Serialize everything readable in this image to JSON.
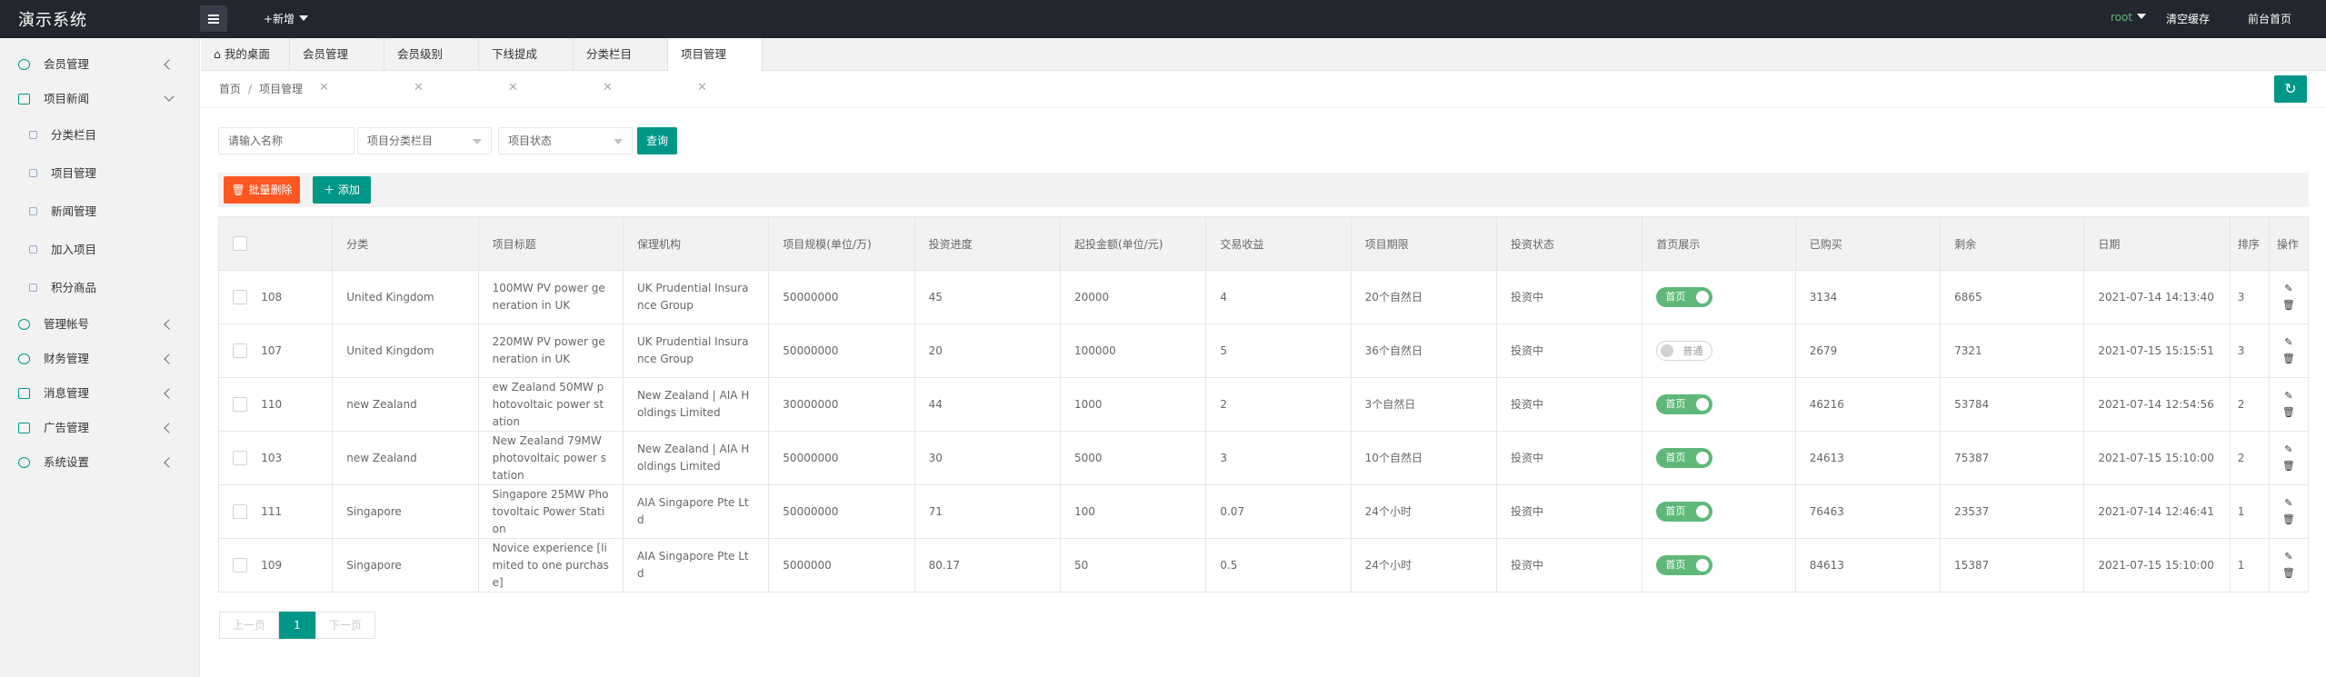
{
  "app": {
    "title": "演示系统",
    "new_label": "+新增"
  },
  "top_right": {
    "user": "root",
    "clear_cache": "清空缓存",
    "front_home": "前台首页"
  },
  "sidebar": {
    "items": [
      {
        "label": "会员管理"
      },
      {
        "label": "项目新闻"
      },
      {
        "label": "分类栏目"
      },
      {
        "label": "项目管理"
      },
      {
        "label": "新闻管理"
      },
      {
        "label": "加入项目"
      },
      {
        "label": "积分商品"
      },
      {
        "label": "管理帐号"
      },
      {
        "label": "财务管理"
      },
      {
        "label": "消息管理"
      },
      {
        "label": "广告管理"
      },
      {
        "label": "系统设置"
      }
    ]
  },
  "tabs": [
    {
      "label": "我的桌面"
    },
    {
      "label": "会员管理"
    },
    {
      "label": "会员级别"
    },
    {
      "label": "下线提成"
    },
    {
      "label": "分类栏目"
    },
    {
      "label": "项目管理"
    }
  ],
  "breadcrumb": {
    "home": "首页",
    "sep": "/",
    "current": "项目管理"
  },
  "filters": {
    "name_placeholder": "请输入名称",
    "category_select": "项目分类栏目",
    "status_select": "项目状态",
    "query_label": "查询"
  },
  "toolbar": {
    "batch_delete": "批量删除",
    "add": "添加"
  },
  "table": {
    "headers": [
      "分类",
      "项目标题",
      "保理机构",
      "项目规模(单位/万)",
      "投资进度",
      "起投金额(单位/元)",
      "交易收益",
      "项目期限",
      "投资状态",
      "首页展示",
      "已购买",
      "剩余",
      "日期",
      "排序",
      "操作"
    ],
    "rows": [
      {
        "id": "108",
        "category": "United Kingdom",
        "title": "100MW PV power generation in UK",
        "agency": "UK Prudential Insurance Group",
        "scale": "50000000",
        "progress": "45",
        "min_invest": "20000",
        "yield": "4",
        "term": "20个自然日",
        "status": "投资中",
        "home_show": "首页",
        "home_on": true,
        "bought": "3134",
        "remaining": "6865",
        "date": "2021-07-14 14:13:40",
        "sort": "3"
      },
      {
        "id": "107",
        "category": "United Kingdom",
        "title": "220MW PV power generation in UK",
        "agency": "UK Prudential Insurance Group",
        "scale": "50000000",
        "progress": "20",
        "min_invest": "100000",
        "yield": "5",
        "term": "36个自然日",
        "status": "投资中",
        "home_show": "普通",
        "home_on": false,
        "bought": "2679",
        "remaining": "7321",
        "date": "2021-07-15 15:15:51",
        "sort": "3"
      },
      {
        "id": "110",
        "category": "new Zealand",
        "title": "ew Zealand 50MW photovoltaic power station",
        "agency": "New Zealand | AIA Holdings Limited",
        "scale": "30000000",
        "progress": "44",
        "min_invest": "1000",
        "yield": "2",
        "term": "3个自然日",
        "status": "投资中",
        "home_show": "首页",
        "home_on": true,
        "bought": "46216",
        "remaining": "53784",
        "date": "2021-07-14 12:54:56",
        "sort": "2"
      },
      {
        "id": "103",
        "category": "new Zealand",
        "title": "New Zealand 79MW photovoltaic power station",
        "agency": "New Zealand | AIA Holdings Limited",
        "scale": "50000000",
        "progress": "30",
        "min_invest": "5000",
        "yield": "3",
        "term": "10个自然日",
        "status": "投资中",
        "home_show": "首页",
        "home_on": true,
        "bought": "24613",
        "remaining": "75387",
        "date": "2021-07-15 15:10:00",
        "sort": "2"
      },
      {
        "id": "111",
        "category": "Singapore",
        "title": "Singapore 25MW Photovoltaic Power Station",
        "agency": "AIA Singapore Pte Ltd",
        "scale": "50000000",
        "progress": "71",
        "min_invest": "100",
        "yield": "0.07",
        "term": "24个小时",
        "status": "投资中",
        "home_show": "首页",
        "home_on": true,
        "bought": "76463",
        "remaining": "23537",
        "date": "2021-07-14 12:46:41",
        "sort": "1"
      },
      {
        "id": "109",
        "category": "Singapore",
        "title": "Novice experience [limited to one purchase]",
        "agency": "AIA Singapore Pte Ltd",
        "scale": "5000000",
        "progress": "80.17",
        "min_invest": "50",
        "yield": "0.5",
        "term": "24个小时",
        "status": "投资中",
        "home_show": "首页",
        "home_on": true,
        "bought": "84613",
        "remaining": "15387",
        "date": "2021-07-15 15:10:00",
        "sort": "1"
      }
    ]
  },
  "pagination": {
    "prev": "上一页",
    "current": "1",
    "next": "下一页"
  },
  "colors": {
    "accent": "#009688",
    "danger": "#ff5722",
    "switch_on": "#5fb878",
    "topbar": "#23262e"
  }
}
